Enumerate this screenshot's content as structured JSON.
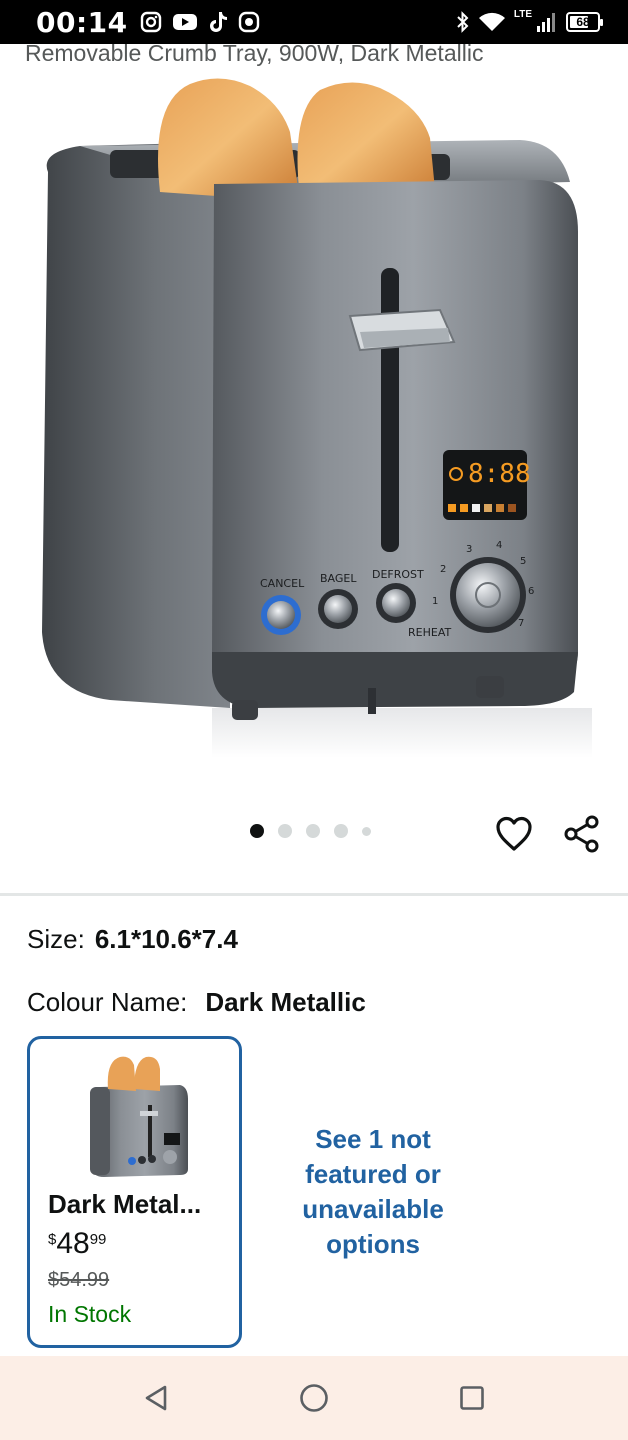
{
  "status_bar": {
    "time": "00:14",
    "network": "LTE",
    "battery": "68",
    "app_icons": [
      "instagram-icon",
      "youtube-icon",
      "tiktok-icon",
      "camera-app-icon"
    ],
    "indicator_icons": [
      "bluetooth-icon",
      "wifi-icon",
      "signal-icon",
      "battery-icon"
    ]
  },
  "product": {
    "title_fragment": "Removable Crumb Tray, 900W, Dark Metallic",
    "image": {
      "display_time": "8:88",
      "button_labels": [
        "CANCEL",
        "BAGEL",
        "DEFROST"
      ],
      "dial_numbers": [
        "1",
        "2",
        "3",
        "4",
        "5",
        "6",
        "7"
      ],
      "reheat_label": "REHEAT"
    }
  },
  "carousel": {
    "total": 5,
    "active_index": 0
  },
  "actions": {
    "wishlist_icon": "heart-icon",
    "share_icon": "share-icon"
  },
  "size": {
    "label": "Size:",
    "value": "6.1*10.6*7.4"
  },
  "colour": {
    "label": "Colour Name:",
    "value": "Dark Metallic"
  },
  "variant": {
    "name": "Dark Metal...",
    "price_symbol": "$",
    "price_whole": "48",
    "price_fraction": "99",
    "list_price": "$54.99",
    "availability": "In Stock"
  },
  "see_more": "See 1 not featured or unavailable options",
  "nav_bar": {
    "icons": [
      "back-icon",
      "home-icon",
      "recents-icon"
    ]
  },
  "colors": {
    "link_blue": "#2162a1",
    "in_stock_green": "#007600",
    "nav_background": "#fceee6",
    "status_background": "#000000"
  }
}
